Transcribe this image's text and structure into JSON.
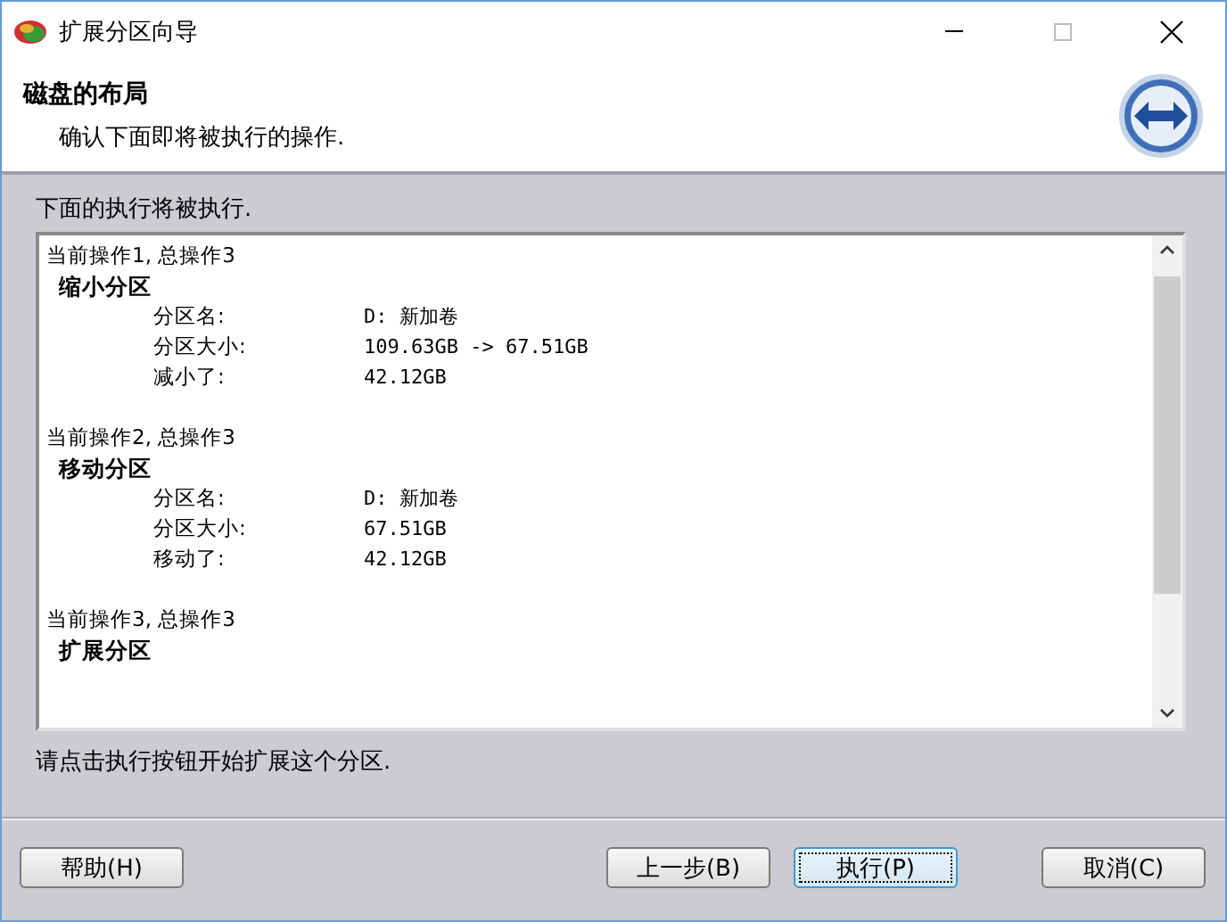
{
  "window": {
    "title": "扩展分区向导"
  },
  "header": {
    "title": "磁盘的布局",
    "subtitle": "确认下面即将被执行的操作."
  },
  "list_label": "下面的执行将被执行.",
  "operations": [
    {
      "step": "当前操作1, 总操作3",
      "title": "缩小分区",
      "fields": [
        {
          "label": "分区名:",
          "value": "D: 新加卷"
        },
        {
          "label": "分区大小:",
          "value": "109.63GB -> 67.51GB"
        },
        {
          "label": "减小了:",
          "value": "42.12GB"
        }
      ]
    },
    {
      "step": "当前操作2, 总操作3",
      "title": "移动分区",
      "fields": [
        {
          "label": "分区名:",
          "value": "D: 新加卷"
        },
        {
          "label": "分区大小:",
          "value": "67.51GB"
        },
        {
          "label": "移动了:",
          "value": "42.12GB"
        }
      ]
    },
    {
      "step": "当前操作3, 总操作3",
      "title": "扩展分区"
    }
  ],
  "hint": "请点击执行按钮开始扩展这个分区.",
  "buttons": [
    {
      "label": "帮助(H)",
      "focused": false
    },
    {
      "label": "上一步(B)",
      "focused": false
    },
    {
      "label": "执行(P)",
      "focused": true
    },
    {
      "label": "取消(C)",
      "focused": false
    }
  ]
}
